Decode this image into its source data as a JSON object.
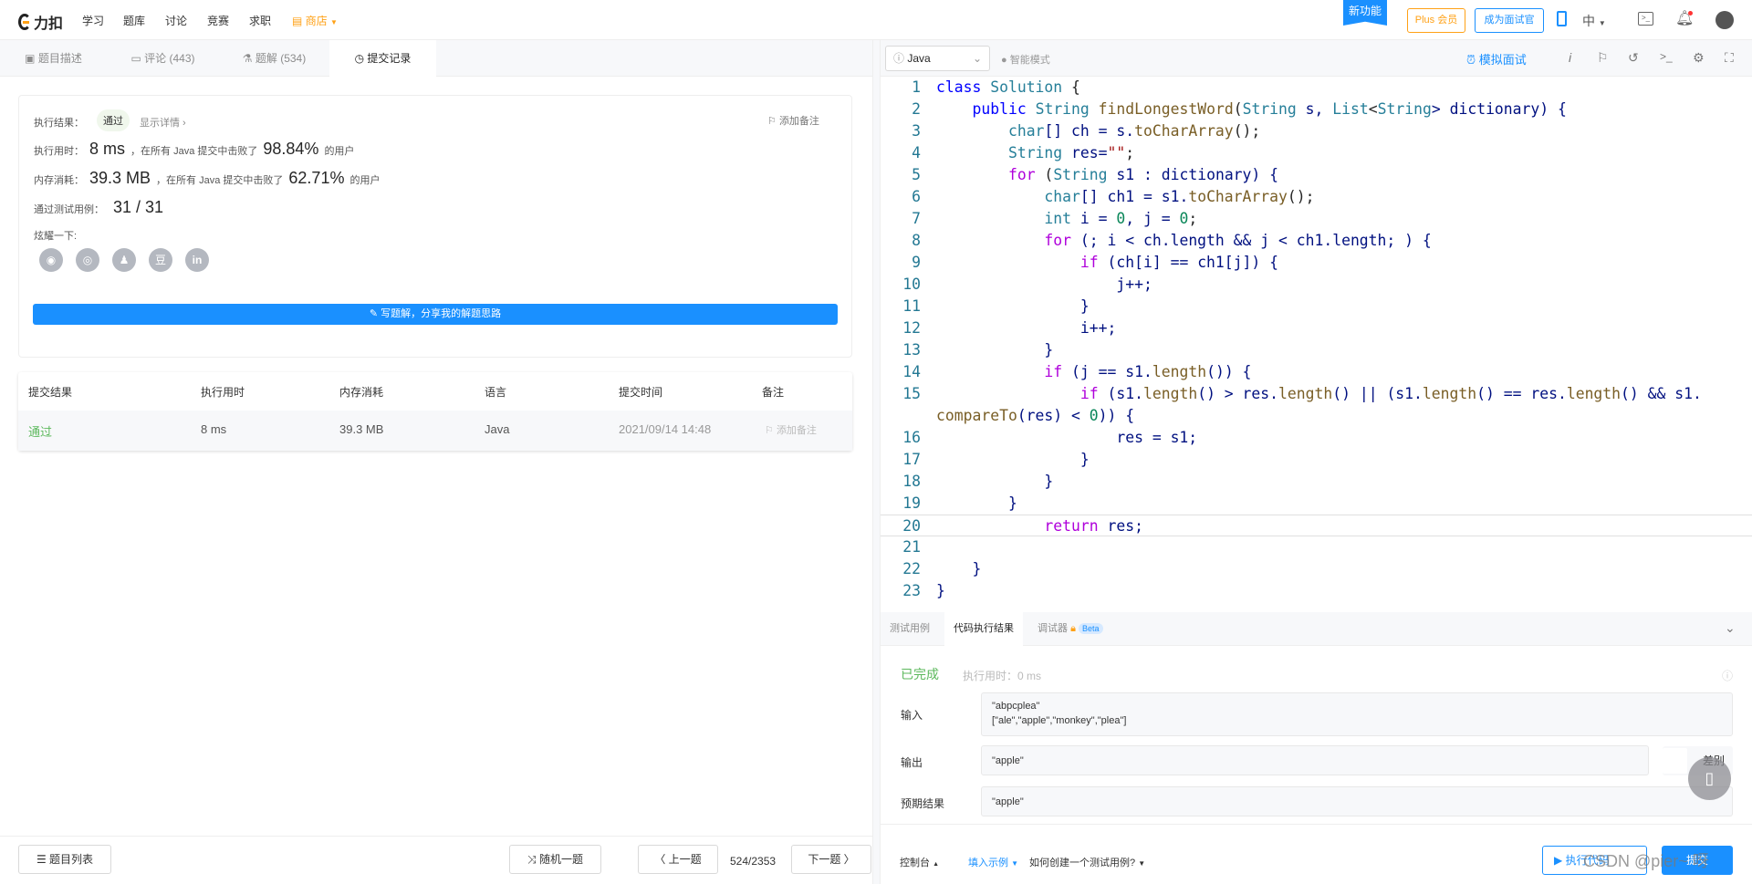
{
  "nav": {
    "brand": "力扣",
    "items": [
      "学习",
      "题库",
      "讨论",
      "竞赛",
      "求职"
    ],
    "shop": "商店",
    "new_feature": "新功能",
    "plus": "Plus 会员",
    "interviewer": "成为面试官",
    "lang": "中"
  },
  "left_tabs": [
    {
      "label": "题目描述"
    },
    {
      "label": "评论 (443)"
    },
    {
      "label": "题解 (534)"
    },
    {
      "label": "提交记录"
    }
  ],
  "result": {
    "exec_label": "执行结果：",
    "status": "通过",
    "details": "显示详情 ›",
    "add_note": "添加备注",
    "time_label": "执行用时：",
    "time": "8 ms",
    "time_mid": "，在所有 Java 提交中击败了",
    "time_pct": "98.84%",
    "users": "的用户",
    "mem_label": "内存消耗：",
    "mem": "39.3 MB",
    "mem_mid": "，在所有 Java 提交中击败了",
    "mem_pct": "62.71%",
    "tests_label": "通过测试用例：",
    "tests": "31 / 31",
    "share_label": "炫耀一下:",
    "share_icons": [
      "wechat-icon",
      "weibo-icon",
      "qq-icon",
      "douban-icon",
      "linkedin-icon"
    ],
    "write_solution": "写题解，分享我的解题思路"
  },
  "table": {
    "headers": [
      "提交结果",
      "执行用时",
      "内存消耗",
      "语言",
      "提交时间",
      "备注"
    ],
    "rows": [
      {
        "result": "通过",
        "time": "8 ms",
        "memory": "39.3 MB",
        "language": "Java",
        "submitted": "2021/09/14 14:48",
        "note": "添加备注"
      }
    ]
  },
  "bottom": {
    "problem_list": "题目列表",
    "random": "随机一题",
    "prev": "上一题",
    "page": "524/2353",
    "next": "下一题"
  },
  "editor": {
    "language": "Java",
    "smart_mode": "智能模式",
    "mock_interview": "模拟面试",
    "lines": [
      {
        "n": "1",
        "tokens": [
          [
            "class",
            "k"
          ],
          [
            " ",
            ""
          ],
          [
            "Solution",
            "t"
          ],
          [
            " {",
            ""
          ]
        ]
      },
      {
        "n": "2",
        "tokens": [
          [
            "    ",
            ""
          ],
          [
            "public",
            "k"
          ],
          [
            " ",
            ""
          ],
          [
            "String",
            "t"
          ],
          [
            " ",
            ""
          ],
          [
            "findLongestWord",
            "f"
          ],
          [
            "(",
            ""
          ],
          [
            "String",
            "t"
          ],
          [
            " s, ",
            "p"
          ],
          [
            "List",
            "t"
          ],
          [
            "<",
            ""
          ],
          [
            "String",
            "t"
          ],
          [
            "> dictionary) {",
            "p"
          ]
        ]
      },
      {
        "n": "3",
        "tokens": [
          [
            "        ",
            ""
          ],
          [
            "char",
            "t"
          ],
          [
            "[] ch = s.",
            "p"
          ],
          [
            "toCharArray",
            "f"
          ],
          [
            "();",
            ""
          ]
        ]
      },
      {
        "n": "4",
        "tokens": [
          [
            "        ",
            ""
          ],
          [
            "String",
            "t"
          ],
          [
            " res=",
            "p"
          ],
          [
            "\"\"",
            "s"
          ],
          [
            ";",
            ""
          ]
        ]
      },
      {
        "n": "5",
        "tokens": [
          [
            "        ",
            ""
          ],
          [
            "for",
            "c"
          ],
          [
            " (",
            ""
          ],
          [
            "String",
            "t"
          ],
          [
            " s1 : dictionary) {",
            "p"
          ]
        ]
      },
      {
        "n": "6",
        "tokens": [
          [
            "            ",
            ""
          ],
          [
            "char",
            "t"
          ],
          [
            "[] ch1 = s1.",
            "p"
          ],
          [
            "toCharArray",
            "f"
          ],
          [
            "();",
            ""
          ]
        ]
      },
      {
        "n": "7",
        "tokens": [
          [
            "            ",
            ""
          ],
          [
            "int",
            "t"
          ],
          [
            " i = ",
            "p"
          ],
          [
            "0",
            "n"
          ],
          [
            ", j = ",
            "p"
          ],
          [
            "0",
            "n"
          ],
          [
            ";",
            ""
          ]
        ]
      },
      {
        "n": "8",
        "tokens": [
          [
            "            ",
            ""
          ],
          [
            "for",
            "c"
          ],
          [
            " (; i < ch.length && j < ch1.length; ) {",
            "p"
          ]
        ]
      },
      {
        "n": "9",
        "tokens": [
          [
            "                ",
            ""
          ],
          [
            "if",
            "c"
          ],
          [
            " (ch[i] == ch1[j]) {",
            "p"
          ]
        ]
      },
      {
        "n": "10",
        "tokens": [
          [
            "                    j++;",
            "p"
          ]
        ]
      },
      {
        "n": "11",
        "tokens": [
          [
            "                }",
            "p"
          ]
        ]
      },
      {
        "n": "12",
        "tokens": [
          [
            "                i++;",
            "p"
          ]
        ]
      },
      {
        "n": "13",
        "tokens": [
          [
            "            }",
            "p"
          ]
        ]
      },
      {
        "n": "14",
        "tokens": [
          [
            "            ",
            ""
          ],
          [
            "if",
            "c"
          ],
          [
            " (j == s1.",
            "p"
          ],
          [
            "length",
            "f"
          ],
          [
            "()) {",
            "p"
          ]
        ]
      },
      {
        "n": "15",
        "tokens": [
          [
            "                ",
            ""
          ],
          [
            "if",
            "c"
          ],
          [
            " (s1.",
            "p"
          ],
          [
            "length",
            "f"
          ],
          [
            "() > res.",
            "p"
          ],
          [
            "length",
            "f"
          ],
          [
            "() || (s1.",
            "p"
          ],
          [
            "length",
            "f"
          ],
          [
            "() == res.",
            "p"
          ],
          [
            "length",
            "f"
          ],
          [
            "() && s1.",
            "p"
          ]
        ]
      },
      {
        "n": "",
        "tokens": [
          [
            "compareTo",
            "f"
          ],
          [
            "(res) < ",
            "p"
          ],
          [
            "0",
            "n"
          ],
          [
            ")) {",
            "p"
          ]
        ]
      },
      {
        "n": "16",
        "tokens": [
          [
            "                    res = s1;",
            "p"
          ]
        ]
      },
      {
        "n": "17",
        "tokens": [
          [
            "                }",
            "p"
          ]
        ]
      },
      {
        "n": "18",
        "tokens": [
          [
            "            }",
            "p"
          ]
        ]
      },
      {
        "n": "19",
        "tokens": [
          [
            "        }",
            "p"
          ]
        ]
      },
      {
        "n": "20",
        "tokens": [
          [
            "            ",
            ""
          ],
          [
            "return",
            "c"
          ],
          [
            " res;",
            "p"
          ]
        ]
      },
      {
        "n": "21",
        "tokens": []
      },
      {
        "n": "22",
        "tokens": [
          [
            "    }",
            "p"
          ]
        ]
      },
      {
        "n": "23",
        "tokens": [
          [
            "}",
            "p"
          ]
        ]
      }
    ]
  },
  "console": {
    "tabs": [
      "测试用例",
      "代码执行结果",
      "调试器"
    ],
    "beta": "Beta",
    "status": "已完成",
    "exec_time": "执行用时：0 ms",
    "input_label": "输入",
    "input_lines": [
      "\"abpcplea\"",
      "[\"ale\",\"apple\",\"monkey\",\"plea\"]"
    ],
    "output_label": "输出",
    "output": "\"apple\"",
    "diff": "差别",
    "expected_label": "预期结果",
    "expected": "\"apple\"",
    "console_label": "控制台",
    "fill_example": "填入示例",
    "how_to": "如何创建一个测试用例?",
    "run": "执行代码",
    "submit": "提交"
  },
  "watermark": "CSDN @pier~ 呀",
  "colors": {
    "accent": "#1a90ff",
    "success": "#5cb85c",
    "shop": "#ffa116"
  }
}
